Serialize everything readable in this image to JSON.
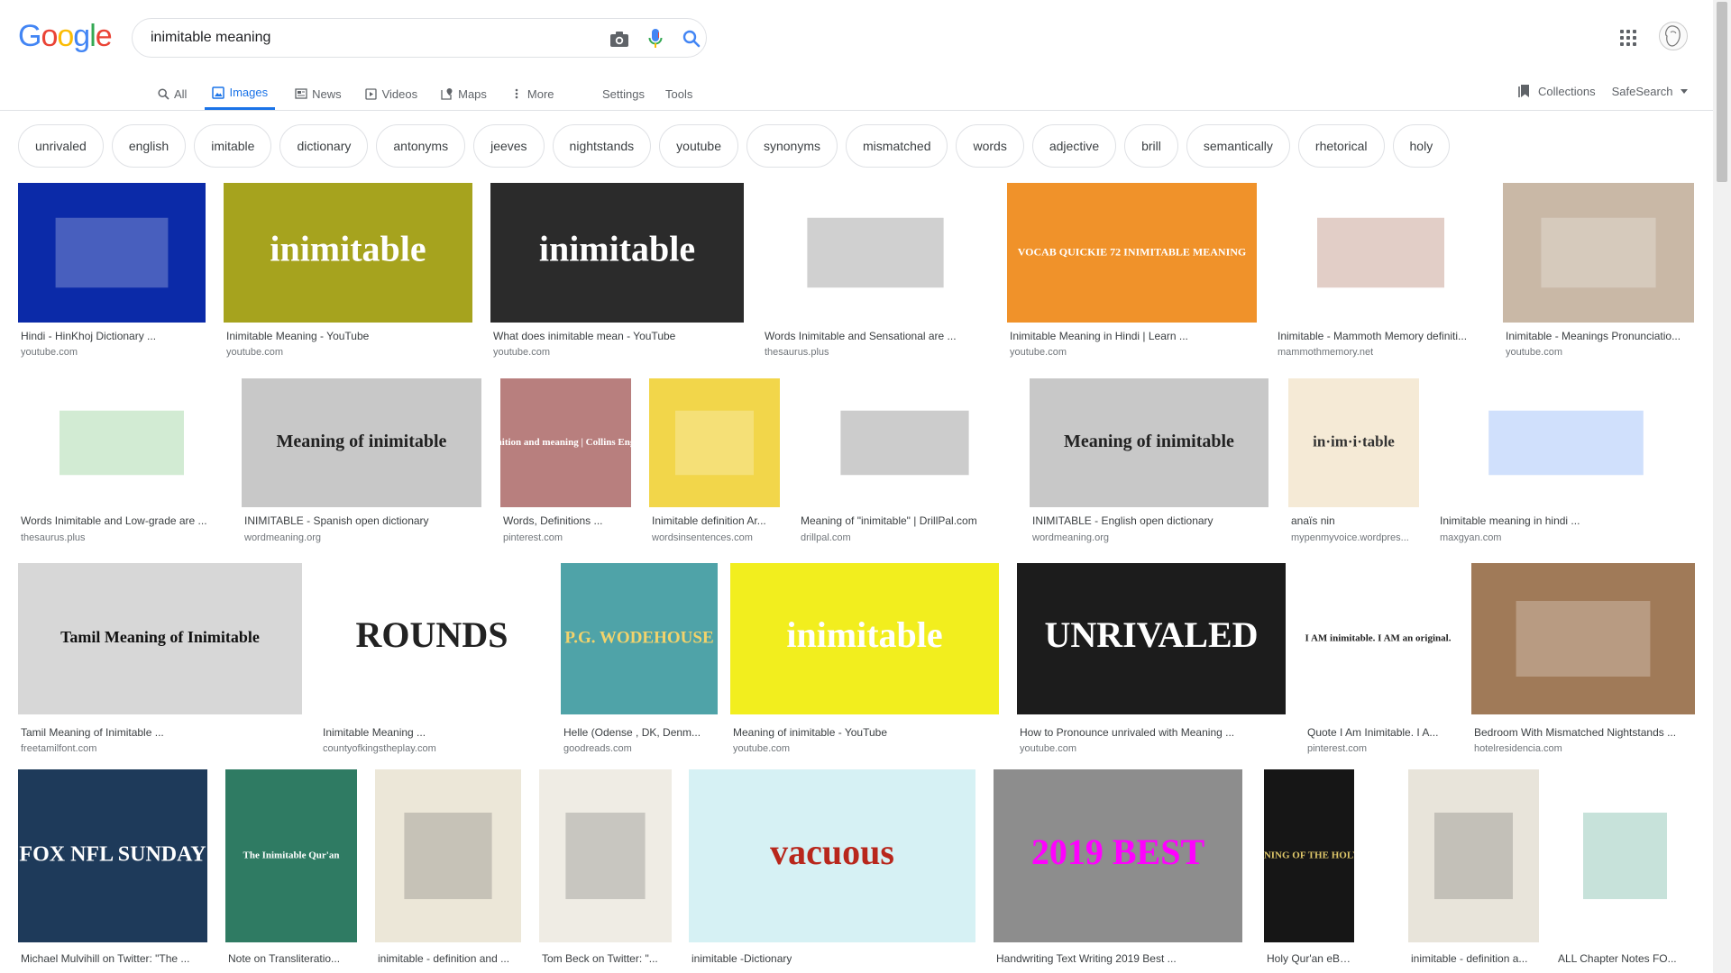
{
  "logo": {
    "letters": [
      "G",
      "o",
      "o",
      "g",
      "l",
      "e"
    ],
    "colors": [
      "#4285f4",
      "#ea4335",
      "#fbbc05",
      "#4285f4",
      "#34a853",
      "#ea4335"
    ]
  },
  "search": {
    "query": "inimitable meaning",
    "camera_icon": "camera-icon",
    "mic_icon": "microphone-icon",
    "search_icon": "search-icon"
  },
  "tabs": [
    {
      "label": "All",
      "icon": "search-icon",
      "active": false
    },
    {
      "label": "Images",
      "icon": "image-icon",
      "active": true
    },
    {
      "label": "News",
      "icon": "news-icon",
      "active": false
    },
    {
      "label": "Videos",
      "icon": "play-icon",
      "active": false
    },
    {
      "label": "Maps",
      "icon": "map-icon",
      "active": false
    },
    {
      "label": "More",
      "icon": "more-vertical-icon",
      "active": false
    }
  ],
  "tools": {
    "settings": "Settings",
    "tools": "Tools"
  },
  "right": {
    "collections": "Collections",
    "safesearch": "SafeSearch"
  },
  "chips": [
    "unrivaled",
    "english",
    "imitable",
    "dictionary",
    "antonyms",
    "jeeves",
    "nightstands",
    "youtube",
    "synonyms",
    "mismatched",
    "words",
    "adjective",
    "brill",
    "semantically",
    "rhetorical",
    "holy"
  ],
  "results": [
    {
      "row": 0,
      "caption": "Hindi - HinKhoj Dictionary ...",
      "source": "youtube.com",
      "bg": "#0b2aa8",
      "label": "",
      "fg": "#ffffff"
    },
    {
      "row": 0,
      "caption": "Inimitable Meaning - YouTube",
      "source": "youtube.com",
      "bg": "#a6a31e",
      "label": "inimitable",
      "fg": "#ffffff"
    },
    {
      "row": 0,
      "caption": "What does inimitable mean - YouTube",
      "source": "youtube.com",
      "bg": "#2b2b2b",
      "label": "inimitable",
      "fg": "#ffffff"
    },
    {
      "row": 0,
      "caption": "Words Inimitable and Sensational are ...",
      "source": "thesaurus.plus",
      "bg": "#ffffff",
      "label": "",
      "fg": "#444444"
    },
    {
      "row": 0,
      "caption": "Inimitable Meaning in Hindi | Learn ...",
      "source": "youtube.com",
      "bg": "#f0922a",
      "label": "VOCAB QUICKIE 72 INIMITABLE MEANING",
      "fg": "#ffffff"
    },
    {
      "row": 0,
      "caption": "Inimitable - Mammoth Memory definiti...",
      "source": "mammothmemory.net",
      "bg": "#ffffff",
      "label": "",
      "fg": "#8b3a1e"
    },
    {
      "row": 0,
      "caption": "Inimitable - Meanings Pronunciatio...",
      "source": "youtube.com",
      "bg": "#c9b8a6",
      "label": "",
      "fg": "#ffffff"
    },
    {
      "row": 1,
      "caption": "Words Inimitable and Low-grade are ...",
      "source": "thesaurus.plus",
      "bg": "#ffffff",
      "label": "",
      "fg": "#4caf50"
    },
    {
      "row": 1,
      "caption": "INIMITABLE - Spanish open dictionary",
      "source": "wordmeaning.org",
      "bg": "#c8c8c8",
      "label": "Meaning of inimitable",
      "fg": "#222222"
    },
    {
      "row": 1,
      "caption": "Words, Definitions ...",
      "source": "pinterest.com",
      "bg": "#b87f7e",
      "label": "Inimitable definition and meaning | Collins English Dictionary",
      "fg": "#ffffff"
    },
    {
      "row": 1,
      "caption": "Inimitable definition Ar...",
      "source": "wordsinsentences.com",
      "bg": "#f2d64a",
      "label": "",
      "fg": "#ffffff"
    },
    {
      "row": 1,
      "caption": "Meaning of \"inimitable\" | DrillPal.com",
      "source": "drillpal.com",
      "bg": "#ffffff",
      "label": "",
      "fg": "#333333"
    },
    {
      "row": 1,
      "caption": "INIMITABLE - English open dictionary",
      "source": "wordmeaning.org",
      "bg": "#c8c8c8",
      "label": "Meaning of inimitable",
      "fg": "#222222"
    },
    {
      "row": 1,
      "caption": "anaïs nin",
      "source": "mypenmyvoice.wordpres...",
      "bg": "#f5ead6",
      "label": "in·im·i·table",
      "fg": "#333333"
    },
    {
      "row": 1,
      "caption": "Inimitable meaning in hindi ...",
      "source": "maxgyan.com",
      "bg": "#ffffff",
      "label": "",
      "fg": "#4285f4"
    },
    {
      "row": 2,
      "caption": "Tamil Meaning of Inimitable ...",
      "source": "freetamilfont.com",
      "bg": "#d7d7d7",
      "label": "Tamil Meaning of Inimitable",
      "fg": "#111111"
    },
    {
      "row": 2,
      "caption": "Inimitable Meaning ...",
      "source": "countyofkingstheplay.com",
      "bg": "#ffffff",
      "label": "ROUNDS",
      "fg": "#222222"
    },
    {
      "row": 2,
      "caption": "Helle (Odense , DK, Denm...",
      "source": "goodreads.com",
      "bg": "#4fa3a8",
      "label": "P.G. WODEHOUSE",
      "fg": "#f3d36b"
    },
    {
      "row": 2,
      "caption": "Meaning of inimitable - YouTube",
      "source": "youtube.com",
      "bg": "#f2ee1e",
      "label": "inimitable",
      "fg": "#ffffff"
    },
    {
      "row": 2,
      "caption": "How to Pronounce unrivaled with Meaning ...",
      "source": "youtube.com",
      "bg": "#1c1c1c",
      "label": "UNRIVALED",
      "fg": "#ffffff"
    },
    {
      "row": 2,
      "caption": "Quote I Am Inimitable. I A...",
      "source": "pinterest.com",
      "bg": "#ffffff",
      "label": "I AM inimitable. I AM an original.",
      "fg": "#222222"
    },
    {
      "row": 2,
      "caption": "Bedroom With Mismatched Nightstands ...",
      "source": "hotelresidencia.com",
      "bg": "#a07a58",
      "label": "",
      "fg": "#ffffff"
    },
    {
      "row": 3,
      "caption": "Michael Mulvihill on Twitter: \"The ...",
      "source": "",
      "bg": "#1e3a5a",
      "label": "FOX NFL SUNDAY",
      "fg": "#ffffff"
    },
    {
      "row": 3,
      "caption": "Note on Transliteratio...",
      "source": "",
      "bg": "#2f7b63",
      "label": "The Inimitable Qur'an",
      "fg": "#ffffff"
    },
    {
      "row": 3,
      "caption": "inimitable - definition and ...",
      "source": "",
      "bg": "#ece7d8",
      "label": "",
      "fg": "#555555"
    },
    {
      "row": 3,
      "caption": "Tom Beck on Twitter: \"...",
      "source": "",
      "bg": "#efece4",
      "label": "",
      "fg": "#555555"
    },
    {
      "row": 3,
      "caption": "inimitable -Dictionary",
      "source": "",
      "bg": "#d6f1f4",
      "label": "vacuous",
      "fg": "#b8271c"
    },
    {
      "row": 3,
      "caption": "Handwriting Text Writing 2019 Best ...",
      "source": "",
      "bg": "#8d8d8d",
      "label": "2019 BEST",
      "fg": "#ff00ff"
    },
    {
      "row": 3,
      "caption": "Holy Qur'an eBook by ...",
      "source": "",
      "bg": "#161616",
      "label": "THE MEANING OF THE HOLY QUR'AN",
      "fg": "#e0c86a"
    },
    {
      "row": 3,
      "caption": "inimitable - definition a...",
      "source": "",
      "bg": "#e8e4da",
      "label": "",
      "fg": "#555555"
    },
    {
      "row": 3,
      "caption": "ALL Chapter Notes FO...",
      "source": "",
      "bg": "#ffffff",
      "label": "",
      "fg": "#1e8a6a"
    }
  ]
}
